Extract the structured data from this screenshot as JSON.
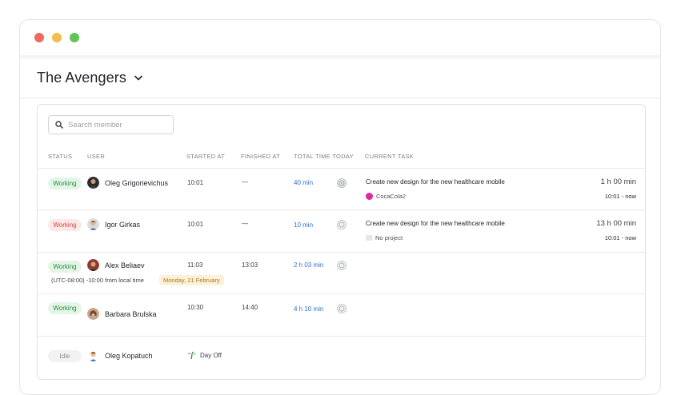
{
  "window": {
    "controls": {
      "close_color": "#ee6a5f",
      "minimize_color": "#f5bd4f",
      "maximize_color": "#61c454"
    }
  },
  "header": {
    "title": "The Avengers",
    "chevron_icon": "chevron-down-icon"
  },
  "search": {
    "placeholder": "Search member",
    "value": ""
  },
  "columns": {
    "status": "STATUS",
    "user": "USER",
    "started_at": "STARTED AT",
    "finished_at": "FINISHED AT",
    "total_time_today": "TOTAL TIME TODAY",
    "current_task": "CURRENT TASK"
  },
  "members": [
    {
      "status": "Working",
      "name": "Oleg Grigorievichus",
      "started_at": "10:01",
      "finished_at": "—",
      "total_time": "40 min",
      "task": "Create new design for the new healthcare mobile",
      "project": "CocaCola2",
      "task_total": "1 h 00 min",
      "task_range": "10:01 - now"
    },
    {
      "status": "Working",
      "name": "Igor Girkas",
      "started_at": "10:01",
      "finished_at": "—",
      "total_time": "10 min",
      "task": "Create new design for the new healthcare mobile",
      "project": "No project",
      "task_total": "13 h 00 min",
      "task_range": "10:01 - now"
    },
    {
      "status": "Working",
      "name": "Alex Beliaev",
      "started_at": "11:03",
      "finished_at": "13:03",
      "total_time": "2 h 03 min",
      "timezone_note": "(UTC-08:00) -10:00 from local time",
      "date_chip": "Monday, 21 February"
    },
    {
      "status": "Working",
      "name": "Barbara Brulska",
      "started_at": "10:30",
      "finished_at": "14:40",
      "total_time": "4 h 10 min"
    },
    {
      "status": "Idle",
      "name": "Oleg Kopatuch",
      "day_off": "Day Off"
    }
  ],
  "colors": {
    "working_bg": "#e3f5e6",
    "working_text": "#2d8a3e",
    "alert_bg": "#fde8e8",
    "alert_text": "#d14545",
    "link_blue": "#2f6fd6",
    "overtime_red": "#e05a4b"
  }
}
